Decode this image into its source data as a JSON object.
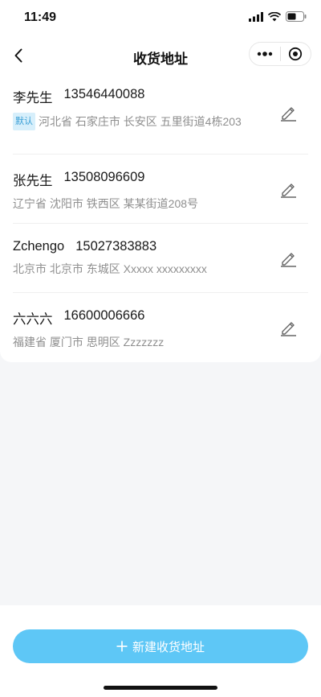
{
  "status_bar": {
    "time": "11:49"
  },
  "nav": {
    "title": "收货地址"
  },
  "addresses": [
    {
      "name": "李先生",
      "phone": "13546440088",
      "default_tag": "默认",
      "address": "河北省 石家庄市 长安区 五里街道4栋203"
    },
    {
      "name": "张先生",
      "phone": "13508096609",
      "address": "辽宁省 沈阳市 铁西区 某某街道208号"
    },
    {
      "name": "Zchengo",
      "phone": "15027383883",
      "address": "北京市 北京市 东城区 Xxxxx xxxxxxxxx"
    },
    {
      "name": "六六六",
      "phone": "16600006666",
      "address": "福建省 厦门市 思明区 Zzzzzzz"
    }
  ],
  "footer": {
    "new_button_label": "新建收货地址"
  },
  "colors": {
    "accent": "#5ec7f6",
    "tag_bg": "#d7effb",
    "tag_text": "#3a9fd6"
  }
}
